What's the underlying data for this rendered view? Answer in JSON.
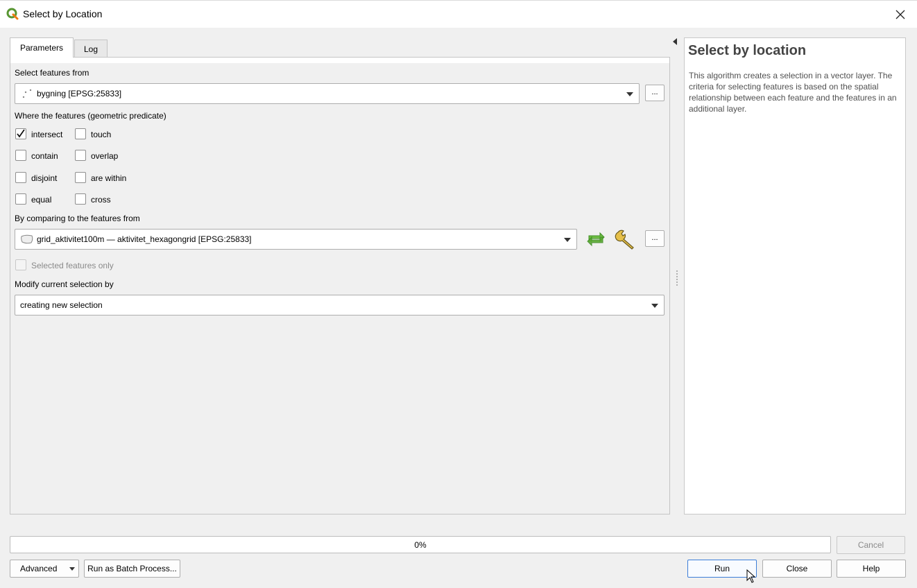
{
  "window": {
    "title": "Select by Location",
    "icon": "qgis-logo-icon",
    "close_icon": "close-icon"
  },
  "tabs": [
    {
      "label": "Parameters",
      "active": true
    },
    {
      "label": "Log",
      "active": false
    }
  ],
  "params": {
    "select_features_from": {
      "label": "Select features from",
      "value": "bygning [EPSG:25833]",
      "layer_icon": "point-layer-icon"
    },
    "predicate": {
      "label": "Where the features (geometric predicate)",
      "options": [
        {
          "label": "intersect",
          "checked": true
        },
        {
          "label": "touch",
          "checked": false
        },
        {
          "label": "contain",
          "checked": false
        },
        {
          "label": "overlap",
          "checked": false
        },
        {
          "label": "disjoint",
          "checked": false
        },
        {
          "label": "are within",
          "checked": false
        },
        {
          "label": "equal",
          "checked": false
        },
        {
          "label": "cross",
          "checked": false
        }
      ]
    },
    "compare_layer": {
      "label": "By comparing to the features from",
      "value": "grid_aktivitet100m — aktivitet_hexagongrid [EPSG:25833]",
      "layer_icon": "polygon-layer-icon"
    },
    "selected_only": {
      "label": "Selected features only",
      "checked": false,
      "enabled": false
    },
    "modify_selection": {
      "label": "Modify current selection by",
      "value": "creating new selection"
    },
    "dots_label": "..."
  },
  "help": {
    "title": "Select by location",
    "body": "This algorithm creates a selection in a vector layer. The criteria for selecting features is based on the spatial relationship between each feature and the features in an additional layer."
  },
  "progress": {
    "value": 0,
    "text": "0%"
  },
  "buttons": {
    "cancel": "Cancel",
    "advanced": "Advanced",
    "batch": "Run as Batch Process...",
    "run": "Run",
    "close": "Close",
    "help": "Help"
  },
  "colors": {
    "accent_blue": "#3b7dd8",
    "qgis_green": "#4c9a3b",
    "iterate_green": "#56a832",
    "wrench_yellow": "#d9b23a"
  }
}
